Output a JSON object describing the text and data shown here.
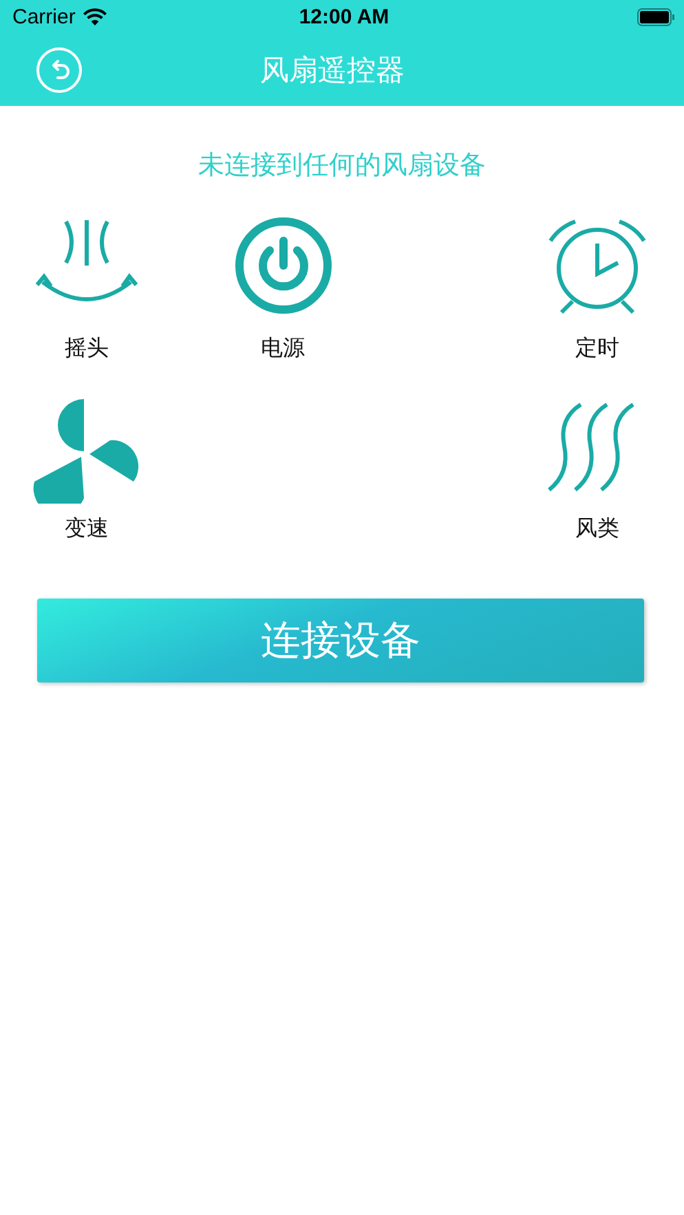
{
  "status_bar": {
    "carrier": "Carrier",
    "time": "12:00 AM"
  },
  "nav_bar": {
    "title": "风扇遥控器"
  },
  "connection_message": "未连接到任何的风扇设备",
  "controls": [
    {
      "kind": "swing",
      "label": "摇头"
    },
    {
      "kind": "power",
      "label": "电源"
    },
    {
      "kind": "timer",
      "label": "定时"
    },
    {
      "kind": "speed",
      "label": "变速"
    },
    {
      "kind": "mode",
      "label": "风类"
    }
  ],
  "connect_button": "连接设备"
}
